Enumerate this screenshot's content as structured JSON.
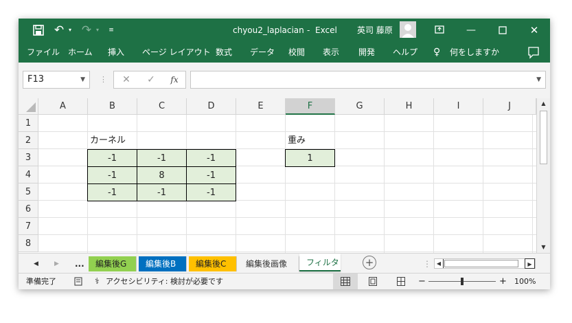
{
  "title": {
    "filename": "chyou2_laplacian",
    "separator": "-",
    "app": "Excel",
    "user": "英司 藤原"
  },
  "menu": [
    "ファイル",
    "ホーム",
    "挿入",
    "ページ レイアウト",
    "数式",
    "データ",
    "校閲",
    "表示",
    "開発",
    "ヘルプ",
    "何をしますか"
  ],
  "formula_bar": {
    "name_box": "F13",
    "fx": "fx",
    "cancel": "✕",
    "enter": "✓",
    "formula": ""
  },
  "columns": [
    "A",
    "B",
    "C",
    "D",
    "E",
    "F",
    "G",
    "H",
    "I",
    "J"
  ],
  "selected_column": "F",
  "rows": [
    "1",
    "2",
    "3",
    "4",
    "5",
    "6",
    "7",
    "8"
  ],
  "cells": {
    "kernel_label": "カーネル",
    "weight_label": "重み",
    "kernel": [
      [
        "-1",
        "-1",
        "-1"
      ],
      [
        "-1",
        "8",
        "-1"
      ],
      [
        "-1",
        "-1",
        "-1"
      ]
    ],
    "weight": "1"
  },
  "sheet_tabs": [
    {
      "label": "...",
      "color": ""
    },
    {
      "label": "編集後G",
      "color": "#92d050"
    },
    {
      "label": "編集後B",
      "color": "#0070c0"
    },
    {
      "label": "編集後C",
      "color": "#ffc000"
    },
    {
      "label": "編集後画像",
      "color": ""
    },
    {
      "label": "フィルタ",
      "color": "",
      "active": true
    }
  ],
  "status": {
    "ready": "準備完了",
    "accessibility": "アクセシビリティ: 検討が必要です",
    "zoom_minus": "−",
    "zoom_plus": "+",
    "zoom": "100%"
  },
  "colors": {
    "excel_green": "#1e7145",
    "kernel_fill": "#e2efda"
  }
}
